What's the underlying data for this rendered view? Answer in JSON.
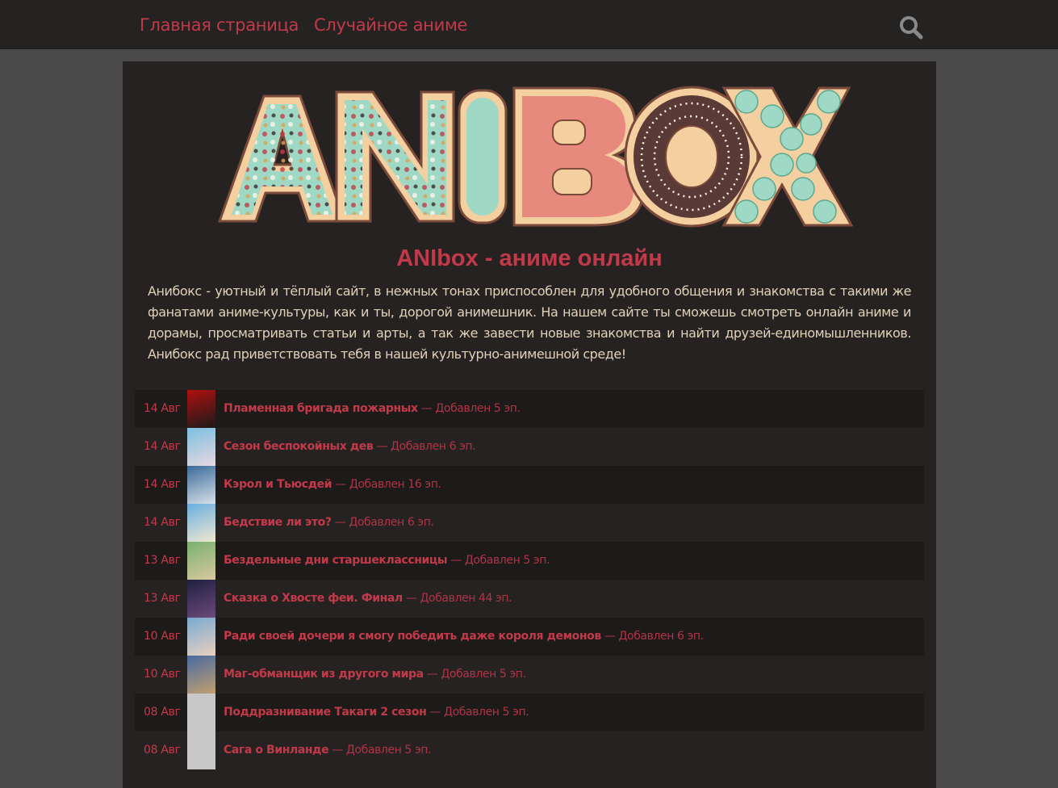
{
  "nav": {
    "home": "Главная страница",
    "random": "Случайное аниме"
  },
  "logo": {
    "text": "ANIBOX"
  },
  "site_title": "ANIbox - аниме онлайн",
  "intro": "Анибокс - уютный и тёплый сайт, в нежных тонах приспособлен для удобного общения и знакомства с такими же фанатами аниме-культуры, как и ты, дорогой анимешник. На нашем сайте ты сможешь смотреть онлайн аниме и дорамы, просматривать статьи и арты, а так же завести новые знакомства и найти друзей-единомышленников. Анибокс рад приветствовать тебя в нашей культурно-анимешной среде!",
  "updates": [
    {
      "date": "14 Авг",
      "title": "Пламенная бригада пожарных",
      "added": " — Добавлен 5 эп."
    },
    {
      "date": "14 Авг",
      "title": "Сезон беспокойных дев",
      "added": " — Добавлен 6 эп."
    },
    {
      "date": "14 Авг",
      "title": "Кэрол и Тьюсдей",
      "added": " — Добавлен 16 эп."
    },
    {
      "date": "14 Авг",
      "title": "Бедствие ли это?",
      "added": " — Добавлен 6 эп."
    },
    {
      "date": "13 Авг",
      "title": "Бездельные дни старшеклассницы",
      "added": " — Добавлен 5 эп."
    },
    {
      "date": "13 Авг",
      "title": "Сказка о Хвосте феи. Финал",
      "added": " — Добавлен 44 эп."
    },
    {
      "date": "10 Авг",
      "title": "Ради своей дочери я смогу победить даже короля демонов",
      "added": " — Добавлен 6 эп."
    },
    {
      "date": "10 Авг",
      "title": "Маг-обманщик из другого мира",
      "added": " — Добавлен 5 эп."
    },
    {
      "date": "08 Авг",
      "title": "Поддразнивание Такаги 2 сезон",
      "added": " — Добавлен 5 эп."
    },
    {
      "date": "08 Авг",
      "title": "Сага о Винланде",
      "added": " — Добавлен 5 эп."
    }
  ],
  "colors": {
    "accent": "#c23a4a",
    "topbar": "#252222",
    "panel": "#262222",
    "row_dark": "#1d1a1a",
    "intro_text": "#e0d2b8"
  },
  "icons": {
    "search": "search-icon"
  }
}
